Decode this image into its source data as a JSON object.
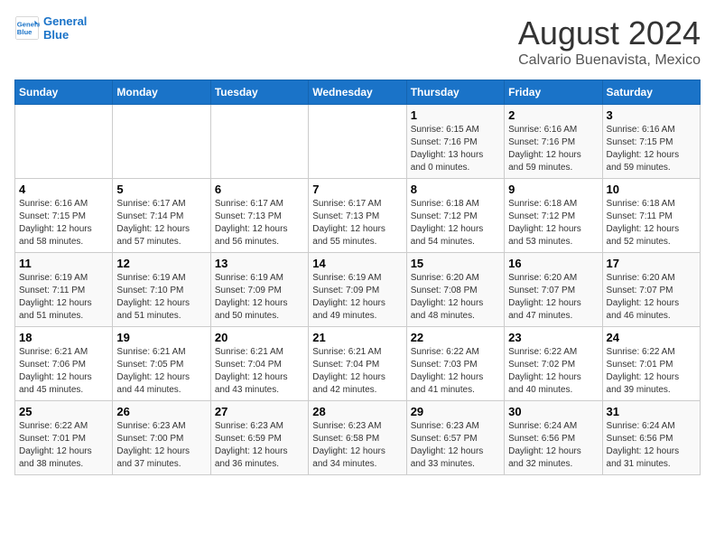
{
  "header": {
    "logo_line1": "General",
    "logo_line2": "Blue",
    "main_title": "August 2024",
    "subtitle": "Calvario Buenavista, Mexico"
  },
  "days_of_week": [
    "Sunday",
    "Monday",
    "Tuesday",
    "Wednesday",
    "Thursday",
    "Friday",
    "Saturday"
  ],
  "weeks": [
    [
      {
        "day": "",
        "info": ""
      },
      {
        "day": "",
        "info": ""
      },
      {
        "day": "",
        "info": ""
      },
      {
        "day": "",
        "info": ""
      },
      {
        "day": "1",
        "info": "Sunrise: 6:15 AM\nSunset: 7:16 PM\nDaylight: 13 hours\nand 0 minutes."
      },
      {
        "day": "2",
        "info": "Sunrise: 6:16 AM\nSunset: 7:16 PM\nDaylight: 12 hours\nand 59 minutes."
      },
      {
        "day": "3",
        "info": "Sunrise: 6:16 AM\nSunset: 7:15 PM\nDaylight: 12 hours\nand 59 minutes."
      }
    ],
    [
      {
        "day": "4",
        "info": "Sunrise: 6:16 AM\nSunset: 7:15 PM\nDaylight: 12 hours\nand 58 minutes."
      },
      {
        "day": "5",
        "info": "Sunrise: 6:17 AM\nSunset: 7:14 PM\nDaylight: 12 hours\nand 57 minutes."
      },
      {
        "day": "6",
        "info": "Sunrise: 6:17 AM\nSunset: 7:13 PM\nDaylight: 12 hours\nand 56 minutes."
      },
      {
        "day": "7",
        "info": "Sunrise: 6:17 AM\nSunset: 7:13 PM\nDaylight: 12 hours\nand 55 minutes."
      },
      {
        "day": "8",
        "info": "Sunrise: 6:18 AM\nSunset: 7:12 PM\nDaylight: 12 hours\nand 54 minutes."
      },
      {
        "day": "9",
        "info": "Sunrise: 6:18 AM\nSunset: 7:12 PM\nDaylight: 12 hours\nand 53 minutes."
      },
      {
        "day": "10",
        "info": "Sunrise: 6:18 AM\nSunset: 7:11 PM\nDaylight: 12 hours\nand 52 minutes."
      }
    ],
    [
      {
        "day": "11",
        "info": "Sunrise: 6:19 AM\nSunset: 7:11 PM\nDaylight: 12 hours\nand 51 minutes."
      },
      {
        "day": "12",
        "info": "Sunrise: 6:19 AM\nSunset: 7:10 PM\nDaylight: 12 hours\nand 51 minutes."
      },
      {
        "day": "13",
        "info": "Sunrise: 6:19 AM\nSunset: 7:09 PM\nDaylight: 12 hours\nand 50 minutes."
      },
      {
        "day": "14",
        "info": "Sunrise: 6:19 AM\nSunset: 7:09 PM\nDaylight: 12 hours\nand 49 minutes."
      },
      {
        "day": "15",
        "info": "Sunrise: 6:20 AM\nSunset: 7:08 PM\nDaylight: 12 hours\nand 48 minutes."
      },
      {
        "day": "16",
        "info": "Sunrise: 6:20 AM\nSunset: 7:07 PM\nDaylight: 12 hours\nand 47 minutes."
      },
      {
        "day": "17",
        "info": "Sunrise: 6:20 AM\nSunset: 7:07 PM\nDaylight: 12 hours\nand 46 minutes."
      }
    ],
    [
      {
        "day": "18",
        "info": "Sunrise: 6:21 AM\nSunset: 7:06 PM\nDaylight: 12 hours\nand 45 minutes."
      },
      {
        "day": "19",
        "info": "Sunrise: 6:21 AM\nSunset: 7:05 PM\nDaylight: 12 hours\nand 44 minutes."
      },
      {
        "day": "20",
        "info": "Sunrise: 6:21 AM\nSunset: 7:04 PM\nDaylight: 12 hours\nand 43 minutes."
      },
      {
        "day": "21",
        "info": "Sunrise: 6:21 AM\nSunset: 7:04 PM\nDaylight: 12 hours\nand 42 minutes."
      },
      {
        "day": "22",
        "info": "Sunrise: 6:22 AM\nSunset: 7:03 PM\nDaylight: 12 hours\nand 41 minutes."
      },
      {
        "day": "23",
        "info": "Sunrise: 6:22 AM\nSunset: 7:02 PM\nDaylight: 12 hours\nand 40 minutes."
      },
      {
        "day": "24",
        "info": "Sunrise: 6:22 AM\nSunset: 7:01 PM\nDaylight: 12 hours\nand 39 minutes."
      }
    ],
    [
      {
        "day": "25",
        "info": "Sunrise: 6:22 AM\nSunset: 7:01 PM\nDaylight: 12 hours\nand 38 minutes."
      },
      {
        "day": "26",
        "info": "Sunrise: 6:23 AM\nSunset: 7:00 PM\nDaylight: 12 hours\nand 37 minutes."
      },
      {
        "day": "27",
        "info": "Sunrise: 6:23 AM\nSunset: 6:59 PM\nDaylight: 12 hours\nand 36 minutes."
      },
      {
        "day": "28",
        "info": "Sunrise: 6:23 AM\nSunset: 6:58 PM\nDaylight: 12 hours\nand 34 minutes."
      },
      {
        "day": "29",
        "info": "Sunrise: 6:23 AM\nSunset: 6:57 PM\nDaylight: 12 hours\nand 33 minutes."
      },
      {
        "day": "30",
        "info": "Sunrise: 6:24 AM\nSunset: 6:56 PM\nDaylight: 12 hours\nand 32 minutes."
      },
      {
        "day": "31",
        "info": "Sunrise: 6:24 AM\nSunset: 6:56 PM\nDaylight: 12 hours\nand 31 minutes."
      }
    ]
  ]
}
